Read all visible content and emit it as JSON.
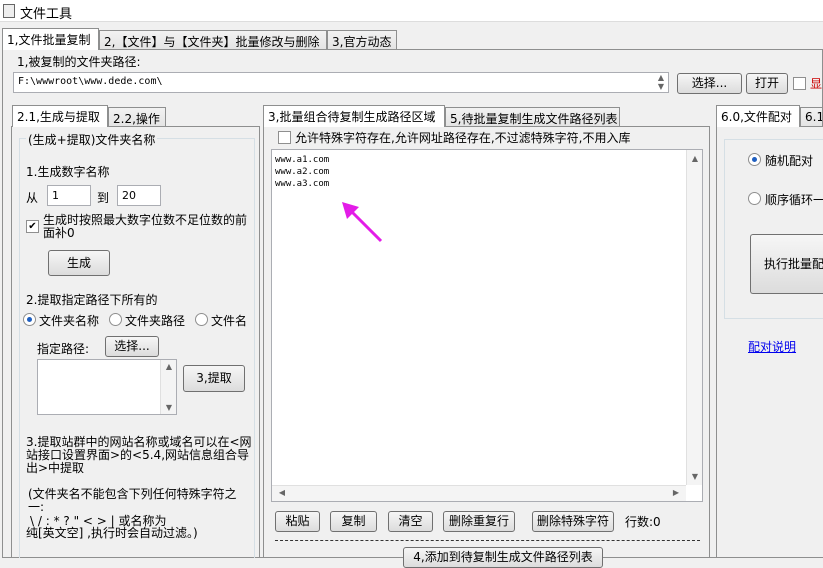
{
  "window": {
    "title": "文件工具"
  },
  "top_tabs": [
    "1,文件批量复制",
    "2,【文件】与【文件夹】批量修改与删除",
    "3,官方动态"
  ],
  "source": {
    "label": "1,被复制的文件夹路径:",
    "path": "F:\\wwwroot\\www.dede.com\\",
    "select_label": "选择...",
    "open_label": "打开",
    "show_label": "显"
  },
  "left": {
    "tabs": [
      "2.1,生成与提取",
      "2.2,操作"
    ],
    "group_title": "(生成+提取)文件夹名称",
    "gen_label": "1.生成数字名称",
    "from_label": "从",
    "from_value": "1",
    "to_label": "到",
    "to_value": "20",
    "pad_label": "生成时按照最大数字位数不足位数的前面补0",
    "gen_button": "生成",
    "extract_label": "2.提取指定路径下所有的",
    "radio1": "文件夹名称",
    "radio2": "文件夹路径",
    "radio3": "文件名",
    "path_label": "指定路径:",
    "path_select": "选择...",
    "extract_button": "3,提取",
    "note1": "3.提取站群中的网站名称或域名可以在<网站接口设置界面>的<5.4,网站信息组合导出>中提取",
    "note2": "(文件夹名不能包含下列任何特殊字符之一:",
    "note3": "\\ / : * ? \" < > | 或名称为",
    "note4": "纯[英文空] ,执行时会自动过滤。)"
  },
  "middle": {
    "tabs": [
      "3,批量组合待复制生成路径区域",
      "5,待批量复制生成文件路径列表"
    ],
    "allow_label": "允许特殊字符存在,允许网址路径存在,不过滤特殊字符,不用入库",
    "lines": [
      "www.a1.com",
      "www.a2.com",
      "www.a3.com"
    ],
    "paste": "粘贴",
    "copy": "复制",
    "clear": "清空",
    "dedupe": "删除重复行",
    "remove_special": "删除特殊字符",
    "count_label": "行数:0",
    "add_button": "4,添加到待复制生成文件路径列表"
  },
  "right": {
    "tabs": [
      "6.0,文件配对",
      "6.1"
    ],
    "random": "随机配对",
    "sequential": "顺序循环一",
    "execute": "执行批量配",
    "help_link": "配对说明"
  },
  "colors": {
    "arrow": "#e31ce8",
    "link": "#0000ee",
    "radio_dot": "#1f5fc0"
  }
}
